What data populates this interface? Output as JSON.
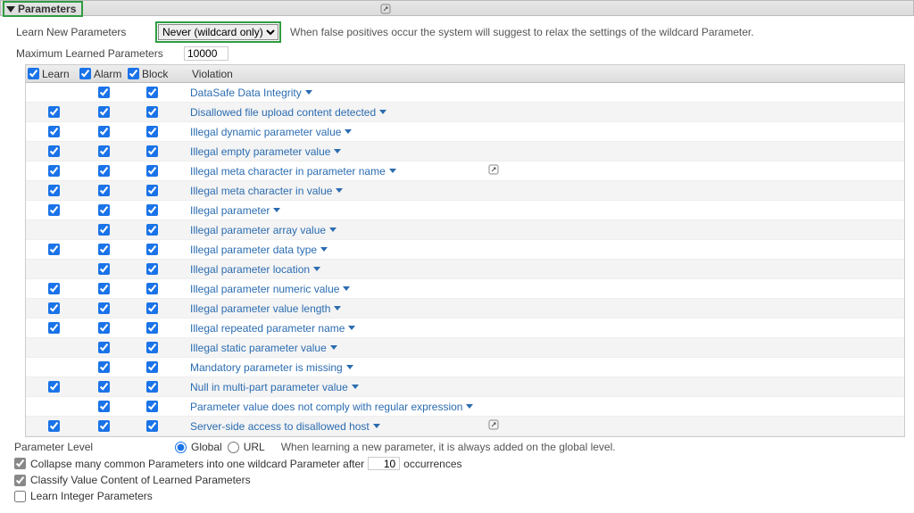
{
  "section": {
    "title": "Parameters"
  },
  "settings": {
    "learn_new_label": "Learn New Parameters",
    "learn_new_value": "Never (wildcard only)",
    "learn_new_hint": "When false positives occur the system will suggest to relax the settings of the wildcard Parameter.",
    "max_label": "Maximum Learned Parameters",
    "max_value": "10000"
  },
  "grid_headers": {
    "learn": "Learn",
    "alarm": "Alarm",
    "block": "Block",
    "violation": "Violation"
  },
  "violations": [
    {
      "label": "DataSafe Data Integrity",
      "learn": false,
      "alarm": true,
      "block": true
    },
    {
      "label": "Disallowed file upload content detected",
      "learn": true,
      "alarm": true,
      "block": true
    },
    {
      "label": "Illegal dynamic parameter value",
      "learn": true,
      "alarm": true,
      "block": true
    },
    {
      "label": "Illegal empty parameter value",
      "learn": true,
      "alarm": true,
      "block": true
    },
    {
      "label": "Illegal meta character in parameter name",
      "learn": true,
      "alarm": true,
      "block": true,
      "pop": true
    },
    {
      "label": "Illegal meta character in value",
      "learn": true,
      "alarm": true,
      "block": true
    },
    {
      "label": "Illegal parameter",
      "learn": true,
      "alarm": true,
      "block": true
    },
    {
      "label": "Illegal parameter array value",
      "learn": false,
      "alarm": true,
      "block": true
    },
    {
      "label": "Illegal parameter data type",
      "learn": true,
      "alarm": true,
      "block": true
    },
    {
      "label": "Illegal parameter location",
      "learn": false,
      "alarm": true,
      "block": true
    },
    {
      "label": "Illegal parameter numeric value",
      "learn": true,
      "alarm": true,
      "block": true
    },
    {
      "label": "Illegal parameter value length",
      "learn": true,
      "alarm": true,
      "block": true
    },
    {
      "label": "Illegal repeated parameter name",
      "learn": true,
      "alarm": true,
      "block": true
    },
    {
      "label": "Illegal static parameter value",
      "learn": false,
      "alarm": true,
      "block": true
    },
    {
      "label": "Mandatory parameter is missing",
      "learn": false,
      "alarm": true,
      "block": true
    },
    {
      "label": "Null in multi-part parameter value",
      "learn": true,
      "alarm": true,
      "block": true
    },
    {
      "label": "Parameter value does not comply with regular expression",
      "learn": false,
      "alarm": true,
      "block": true
    },
    {
      "label": "Server-side access to disallowed host",
      "learn": true,
      "alarm": true,
      "block": true,
      "pop": true
    }
  ],
  "footer": {
    "param_level_label": "Parameter Level",
    "global_label": "Global",
    "url_label": "URL",
    "param_level_hint": "When learning a new parameter, it is always added on the global level.",
    "collapse_label_a": "Collapse many common Parameters into one wildcard Parameter after",
    "collapse_value": "10",
    "collapse_label_b": "occurrences",
    "classify_label": "Classify Value Content of Learned Parameters",
    "learn_int_label": "Learn Integer Parameters",
    "collapse_checked": true,
    "classify_checked": true,
    "learn_int_checked": false
  }
}
